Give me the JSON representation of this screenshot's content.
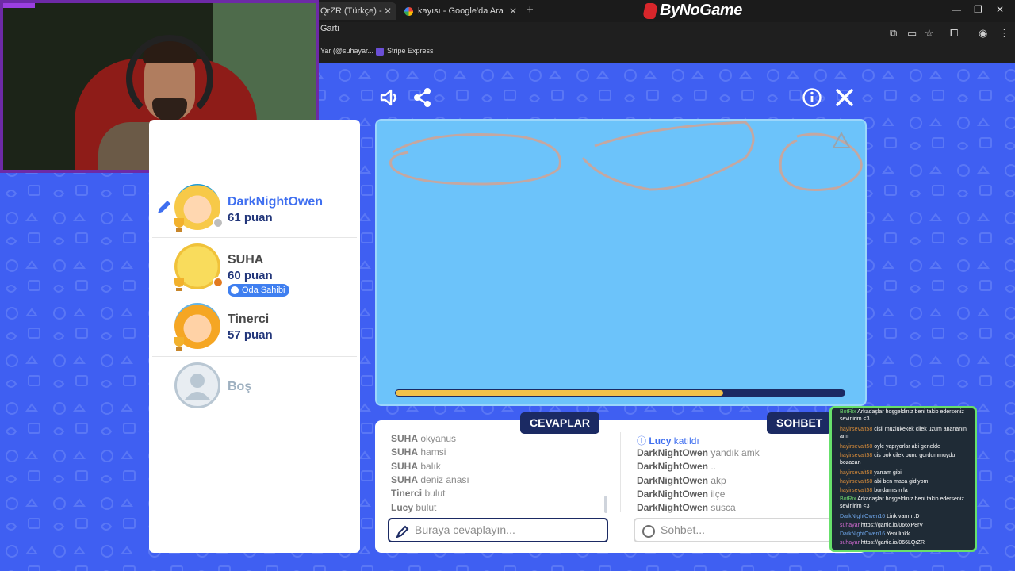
{
  "browser": {
    "tabs": [
      {
        "title": "QrZR (Türkçe) - Garti"
      },
      {
        "title": "kayısı - Google'da Ara"
      }
    ],
    "brand": "ByNoGame",
    "bookmarks": [
      {
        "label": "Yar (@suhayar..."
      },
      {
        "label": "Stripe Express"
      }
    ]
  },
  "players": [
    {
      "name": "DarkNightOwen",
      "score": "61 puan",
      "avatar_color": "#f7c948",
      "drawing": true
    },
    {
      "name": "SUHA",
      "score": "60 puan",
      "badge": "Oda Sahibi",
      "avatar_color": "#f7d94a"
    },
    {
      "name": "Tinerci",
      "score": "57 puan",
      "avatar_color": "#f5a623"
    },
    {
      "name": "Boş"
    }
  ],
  "round": {
    "progress": 0.73
  },
  "answers": {
    "tab_label": "CEVAPLAR",
    "messages": [
      {
        "user": "SUHA",
        "text": "okyanus"
      },
      {
        "user": "SUHA",
        "text": "hamsi"
      },
      {
        "user": "SUHA",
        "text": "balık"
      },
      {
        "user": "SUHA",
        "text": "deniz anası"
      },
      {
        "user": "Tinerci",
        "text": "bulut"
      },
      {
        "user": "Lucy",
        "text": "bulut"
      }
    ],
    "placeholder": "Buraya cevaplayın..."
  },
  "chat": {
    "tab_label": "SOHBET",
    "messages": [
      {
        "user": "Lucy",
        "text": "katıldı",
        "system": true
      },
      {
        "user": "DarkNightOwen",
        "text": "yandık amk"
      },
      {
        "user": "DarkNightOwen",
        "text": ".."
      },
      {
        "user": "DarkNightOwen",
        "text": "akp"
      },
      {
        "user": "DarkNightOwen",
        "text": "ilçe"
      },
      {
        "user": "DarkNightOwen",
        "text": "susca"
      }
    ],
    "placeholder": "Sohbet..."
  },
  "stream_chat": [
    {
      "user": "BotRix",
      "text": "Arkadaşlar hoşgeldiniz beni takip ederseniz sevinirim <3"
    },
    {
      "user": "hayirsevalt58",
      "text": "cisli muzlukekek cilek üzüm anananın amı"
    },
    {
      "user": "hayirsevalt58",
      "text": "oyle yapıyorlar abi genelde"
    },
    {
      "user": "hayirsevalt58",
      "text": "cis bok cilek bunu gordummuydu bozacan"
    },
    {
      "user": "hayirsevalt58",
      "text": "yarram gibi"
    },
    {
      "user": "hayirsevalt58",
      "text": "abi ben maca gidiyom"
    },
    {
      "user": "hayirsevalt58",
      "text": "burdamısın la"
    },
    {
      "user": "BotRix",
      "text": "Arkadaşlar hoşgeldiniz beni takip ederseniz sevinirim <3"
    },
    {
      "user": "DarkNightOwen16",
      "text": "Link varmı :D"
    },
    {
      "user": "suhayar",
      "text": "https://gartic.io/066xP8rV"
    },
    {
      "user": "DarkNightOwen16",
      "text": "Yeni linkk"
    },
    {
      "user": "suhayar",
      "text": "https://gartic.io/066LQrZR"
    }
  ]
}
